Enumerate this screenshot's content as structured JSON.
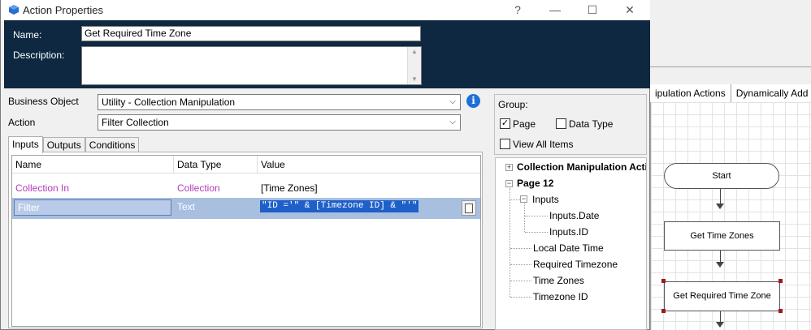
{
  "window": {
    "title": "Action Properties",
    "help": "?",
    "minimize": "—",
    "maximize": "☐",
    "close": "✕"
  },
  "header": {
    "name_label": "Name:",
    "name_value": "Get Required Time Zone",
    "description_label": "Description:",
    "description_value": ""
  },
  "form": {
    "business_object_label": "Business Object",
    "business_object_value": "Utility - Collection Manipulation",
    "action_label": "Action",
    "action_value": "Filter Collection",
    "info": "i"
  },
  "tabs": [
    "Inputs",
    "Outputs",
    "Conditions"
  ],
  "grid": {
    "headers": [
      "Name",
      "Data Type",
      "Value"
    ],
    "rows": [
      {
        "name": "Collection In",
        "data_type": "Collection",
        "value": "[Time Zones]"
      },
      {
        "name": "Filter",
        "data_type": "Text",
        "value": "\"ID ='\" & [Timezone ID] & \"'\""
      }
    ]
  },
  "group": {
    "label": "Group:",
    "page_label": "Page",
    "page_checked": true,
    "data_type_label": "Data Type",
    "data_type_checked": false,
    "view_all_label": "View All Items",
    "view_all_checked": false
  },
  "tree": {
    "collection_manipulation": "Collection Manipulation Actions",
    "page": "Page 12",
    "inputs": "Inputs",
    "inputs_date": "Inputs.Date",
    "inputs_id": "Inputs.ID",
    "local_date_time": "Local Date Time",
    "required_timezone": "Required Timezone",
    "time_zones": "Time Zones",
    "timezone_id": "Timezone ID"
  },
  "background": {
    "tabs": [
      "ipulation Actions",
      "Dynamically Add Fie"
    ],
    "flow": {
      "start": "Start",
      "step1": "Get Time Zones",
      "step2": "Get Required Time Zone"
    }
  },
  "colors": {
    "header_bg": "#0e2841",
    "purple_text": "#b23bb8",
    "selection": "#1e5fc8",
    "row_highlight": "#a9bfe0"
  }
}
